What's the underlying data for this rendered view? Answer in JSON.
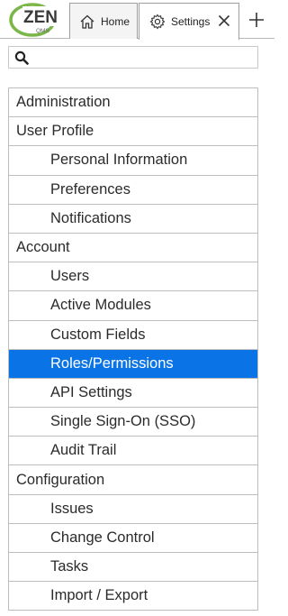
{
  "logo": {
    "big": "ZEN",
    "small": "QMS"
  },
  "tabs": [
    {
      "label": "Home",
      "icon": "home-icon"
    },
    {
      "label": "Settings",
      "icon": "gear-icon"
    }
  ],
  "search": {
    "placeholder": "",
    "value": ""
  },
  "nav": {
    "items": [
      {
        "label": "Administration",
        "level": "section"
      },
      {
        "label": "User Profile",
        "level": "section"
      },
      {
        "label": "Personal Information",
        "level": "child"
      },
      {
        "label": "Preferences",
        "level": "child"
      },
      {
        "label": "Notifications",
        "level": "child"
      },
      {
        "label": "Account",
        "level": "section"
      },
      {
        "label": "Users",
        "level": "child"
      },
      {
        "label": "Active Modules",
        "level": "child"
      },
      {
        "label": "Custom Fields",
        "level": "child"
      },
      {
        "label": "Roles/Permissions",
        "level": "child",
        "selected": true
      },
      {
        "label": "API Settings",
        "level": "child"
      },
      {
        "label": "Single Sign-On (SSO)",
        "level": "child"
      },
      {
        "label": "Audit Trail",
        "level": "child"
      },
      {
        "label": "Configuration",
        "level": "section"
      },
      {
        "label": "Issues",
        "level": "child"
      },
      {
        "label": "Change Control",
        "level": "child"
      },
      {
        "label": "Tasks",
        "level": "child"
      },
      {
        "label": "Import / Export",
        "level": "child"
      }
    ]
  },
  "colors": {
    "selected_bg": "#0a74e6",
    "logo_green": "#7ab648",
    "text": "#2b2b2b"
  }
}
